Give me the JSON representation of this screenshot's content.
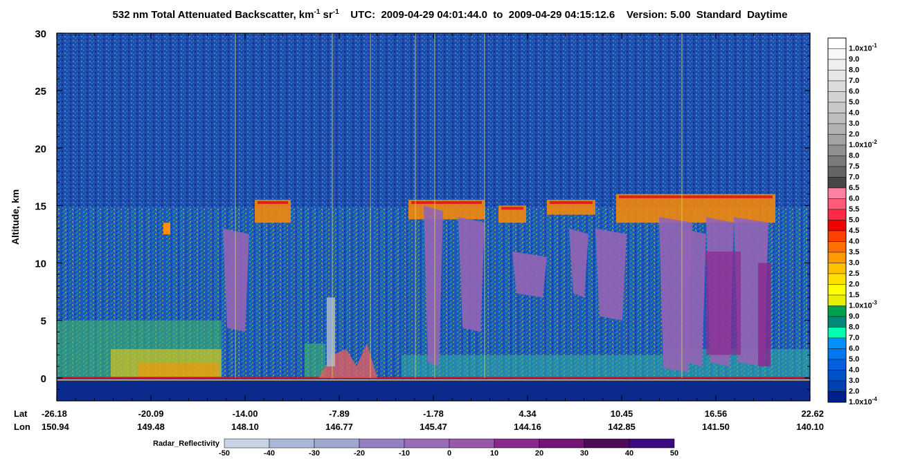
{
  "title": {
    "text_main": "532 nm Total Attenuated Backscatter, km",
    "exp1": "-1",
    "sr_text": " sr",
    "exp2": "-1",
    "rest": "    UTC:  2009-04-29 04:01:44.0  to  2009-04-29 04:15:12.6    Version: 5.00  Standard  Daytime"
  },
  "chart_data": {
    "type": "heatmap",
    "ylabel": "Altitude, km",
    "ylim": [
      -2,
      30
    ],
    "yticks": [
      "30",
      "25",
      "20",
      "15",
      "10",
      "5",
      "0"
    ],
    "ytick_values": [
      30,
      25,
      20,
      15,
      10,
      5,
      0
    ],
    "x_row_label_lat": "Lat",
    "x_row_label_lon": "Lon",
    "lat_ticks": [
      "-26.18",
      "-20.09",
      "-14.00",
      "-7.89",
      "-1.78",
      "4.34",
      "10.45",
      "16.56",
      "22.62"
    ],
    "lon_ticks": [
      "150.94",
      "149.48",
      "148.10",
      "146.77",
      "145.47",
      "144.16",
      "142.85",
      "141.50",
      "140.10"
    ],
    "backscatter_colorbar": {
      "labels": [
        "1.0x10",
        "9.0",
        "8.0",
        "7.0",
        "6.0",
        "5.0",
        "4.0",
        "3.0",
        "2.0",
        "1.0x10",
        "8.0",
        "7.5",
        "7.0",
        "6.5",
        "6.0",
        "5.5",
        "5.0",
        "4.5",
        "4.0",
        "3.5",
        "3.0",
        "2.5",
        "2.0",
        "1.5",
        "1.0x10",
        "9.0",
        "8.0",
        "7.0",
        "6.0",
        "5.0",
        "4.0",
        "3.0",
        "2.0",
        "1.0x10"
      ],
      "exponents": {
        "0": "-1",
        "9": "-2",
        "24": "-3",
        "33": "-4"
      },
      "colors": [
        "#ffffff",
        "#f7f7f7",
        "#efefef",
        "#e6e6e6",
        "#dcdcdc",
        "#d2d2d2",
        "#c8c8c8",
        "#bdbdbd",
        "#b1b1b1",
        "#a3a3a3",
        "#909090",
        "#7b7b7b",
        "#646464",
        "#474747",
        "#ff80a0",
        "#ff5a78",
        "#ff2a4a",
        "#f00000",
        "#ff4000",
        "#ff7000",
        "#ff9a00",
        "#ffc000",
        "#ffe000",
        "#ffff00",
        "#e6f000",
        "#00a050",
        "#008878",
        "#00ffb0",
        "#0090ff",
        "#0078f0",
        "#0060e0",
        "#0050c8",
        "#0040b0",
        "#002090"
      ]
    },
    "radar_colorbar": {
      "label": "Radar_Reflectivity",
      "ticks": [
        "-50",
        "-40",
        "-30",
        "-20",
        "-10",
        "0",
        "10",
        "20",
        "30",
        "40",
        "50"
      ],
      "colors": [
        "#c8d4e6",
        "#a8b8d8",
        "#a0a8d0",
        "#9480c0",
        "#9a6cb8",
        "#9858ac",
        "#8a2890",
        "#761478",
        "#4e0c58",
        "#3c0a80"
      ]
    },
    "colors": {
      "background": "#1e4aa8",
      "deep_blue": "#0a2a8e",
      "cloud_purple": "#9464b4",
      "surface_red": "#e01010"
    }
  }
}
